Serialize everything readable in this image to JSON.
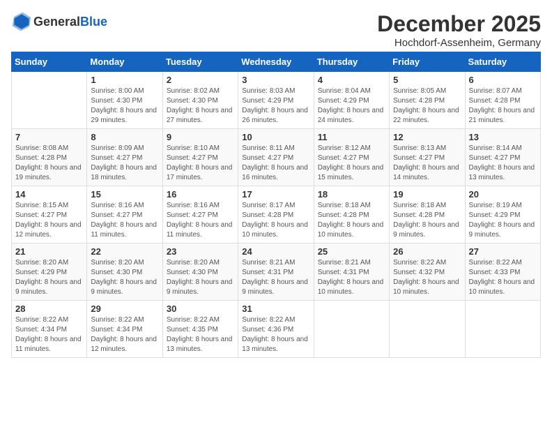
{
  "header": {
    "logo": {
      "text_general": "General",
      "text_blue": "Blue"
    },
    "month_title": "December 2025",
    "subtitle": "Hochdorf-Assenheim, Germany"
  },
  "days_of_week": [
    "Sunday",
    "Monday",
    "Tuesday",
    "Wednesday",
    "Thursday",
    "Friday",
    "Saturday"
  ],
  "weeks": [
    [
      {
        "day": "",
        "sunrise": "",
        "sunset": "",
        "daylight": ""
      },
      {
        "day": "1",
        "sunrise": "Sunrise: 8:00 AM",
        "sunset": "Sunset: 4:30 PM",
        "daylight": "Daylight: 8 hours and 29 minutes."
      },
      {
        "day": "2",
        "sunrise": "Sunrise: 8:02 AM",
        "sunset": "Sunset: 4:30 PM",
        "daylight": "Daylight: 8 hours and 27 minutes."
      },
      {
        "day": "3",
        "sunrise": "Sunrise: 8:03 AM",
        "sunset": "Sunset: 4:29 PM",
        "daylight": "Daylight: 8 hours and 26 minutes."
      },
      {
        "day": "4",
        "sunrise": "Sunrise: 8:04 AM",
        "sunset": "Sunset: 4:29 PM",
        "daylight": "Daylight: 8 hours and 24 minutes."
      },
      {
        "day": "5",
        "sunrise": "Sunrise: 8:05 AM",
        "sunset": "Sunset: 4:28 PM",
        "daylight": "Daylight: 8 hours and 22 minutes."
      },
      {
        "day": "6",
        "sunrise": "Sunrise: 8:07 AM",
        "sunset": "Sunset: 4:28 PM",
        "daylight": "Daylight: 8 hours and 21 minutes."
      }
    ],
    [
      {
        "day": "7",
        "sunrise": "Sunrise: 8:08 AM",
        "sunset": "Sunset: 4:28 PM",
        "daylight": "Daylight: 8 hours and 19 minutes."
      },
      {
        "day": "8",
        "sunrise": "Sunrise: 8:09 AM",
        "sunset": "Sunset: 4:27 PM",
        "daylight": "Daylight: 8 hours and 18 minutes."
      },
      {
        "day": "9",
        "sunrise": "Sunrise: 8:10 AM",
        "sunset": "Sunset: 4:27 PM",
        "daylight": "Daylight: 8 hours and 17 minutes."
      },
      {
        "day": "10",
        "sunrise": "Sunrise: 8:11 AM",
        "sunset": "Sunset: 4:27 PM",
        "daylight": "Daylight: 8 hours and 16 minutes."
      },
      {
        "day": "11",
        "sunrise": "Sunrise: 8:12 AM",
        "sunset": "Sunset: 4:27 PM",
        "daylight": "Daylight: 8 hours and 15 minutes."
      },
      {
        "day": "12",
        "sunrise": "Sunrise: 8:13 AM",
        "sunset": "Sunset: 4:27 PM",
        "daylight": "Daylight: 8 hours and 14 minutes."
      },
      {
        "day": "13",
        "sunrise": "Sunrise: 8:14 AM",
        "sunset": "Sunset: 4:27 PM",
        "daylight": "Daylight: 8 hours and 13 minutes."
      }
    ],
    [
      {
        "day": "14",
        "sunrise": "Sunrise: 8:15 AM",
        "sunset": "Sunset: 4:27 PM",
        "daylight": "Daylight: 8 hours and 12 minutes."
      },
      {
        "day": "15",
        "sunrise": "Sunrise: 8:16 AM",
        "sunset": "Sunset: 4:27 PM",
        "daylight": "Daylight: 8 hours and 11 minutes."
      },
      {
        "day": "16",
        "sunrise": "Sunrise: 8:16 AM",
        "sunset": "Sunset: 4:27 PM",
        "daylight": "Daylight: 8 hours and 11 minutes."
      },
      {
        "day": "17",
        "sunrise": "Sunrise: 8:17 AM",
        "sunset": "Sunset: 4:28 PM",
        "daylight": "Daylight: 8 hours and 10 minutes."
      },
      {
        "day": "18",
        "sunrise": "Sunrise: 8:18 AM",
        "sunset": "Sunset: 4:28 PM",
        "daylight": "Daylight: 8 hours and 10 minutes."
      },
      {
        "day": "19",
        "sunrise": "Sunrise: 8:18 AM",
        "sunset": "Sunset: 4:28 PM",
        "daylight": "Daylight: 8 hours and 9 minutes."
      },
      {
        "day": "20",
        "sunrise": "Sunrise: 8:19 AM",
        "sunset": "Sunset: 4:29 PM",
        "daylight": "Daylight: 8 hours and 9 minutes."
      }
    ],
    [
      {
        "day": "21",
        "sunrise": "Sunrise: 8:20 AM",
        "sunset": "Sunset: 4:29 PM",
        "daylight": "Daylight: 8 hours and 9 minutes."
      },
      {
        "day": "22",
        "sunrise": "Sunrise: 8:20 AM",
        "sunset": "Sunset: 4:30 PM",
        "daylight": "Daylight: 8 hours and 9 minutes."
      },
      {
        "day": "23",
        "sunrise": "Sunrise: 8:20 AM",
        "sunset": "Sunset: 4:30 PM",
        "daylight": "Daylight: 8 hours and 9 minutes."
      },
      {
        "day": "24",
        "sunrise": "Sunrise: 8:21 AM",
        "sunset": "Sunset: 4:31 PM",
        "daylight": "Daylight: 8 hours and 9 minutes."
      },
      {
        "day": "25",
        "sunrise": "Sunrise: 8:21 AM",
        "sunset": "Sunset: 4:31 PM",
        "daylight": "Daylight: 8 hours and 10 minutes."
      },
      {
        "day": "26",
        "sunrise": "Sunrise: 8:22 AM",
        "sunset": "Sunset: 4:32 PM",
        "daylight": "Daylight: 8 hours and 10 minutes."
      },
      {
        "day": "27",
        "sunrise": "Sunrise: 8:22 AM",
        "sunset": "Sunset: 4:33 PM",
        "daylight": "Daylight: 8 hours and 10 minutes."
      }
    ],
    [
      {
        "day": "28",
        "sunrise": "Sunrise: 8:22 AM",
        "sunset": "Sunset: 4:34 PM",
        "daylight": "Daylight: 8 hours and 11 minutes."
      },
      {
        "day": "29",
        "sunrise": "Sunrise: 8:22 AM",
        "sunset": "Sunset: 4:34 PM",
        "daylight": "Daylight: 8 hours and 12 minutes."
      },
      {
        "day": "30",
        "sunrise": "Sunrise: 8:22 AM",
        "sunset": "Sunset: 4:35 PM",
        "daylight": "Daylight: 8 hours and 13 minutes."
      },
      {
        "day": "31",
        "sunrise": "Sunrise: 8:22 AM",
        "sunset": "Sunset: 4:36 PM",
        "daylight": "Daylight: 8 hours and 13 minutes."
      },
      {
        "day": "",
        "sunrise": "",
        "sunset": "",
        "daylight": ""
      },
      {
        "day": "",
        "sunrise": "",
        "sunset": "",
        "daylight": ""
      },
      {
        "day": "",
        "sunrise": "",
        "sunset": "",
        "daylight": ""
      }
    ]
  ]
}
